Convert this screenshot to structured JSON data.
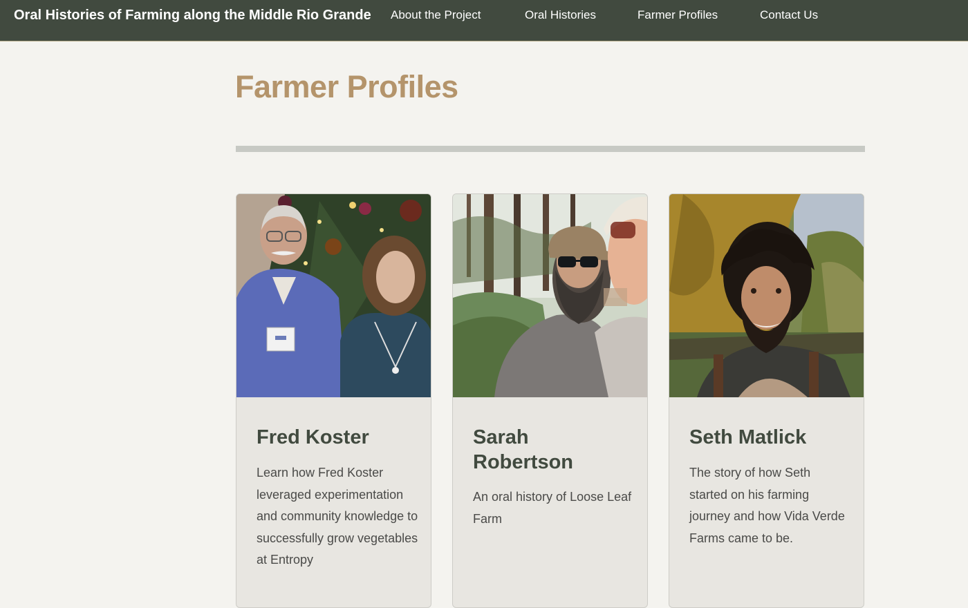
{
  "header": {
    "site_title": "Oral Histories of Farming along the Middle Rio Grande",
    "nav": [
      {
        "label": "About the Project"
      },
      {
        "label": "Oral Histories"
      },
      {
        "label": "Farmer Profiles"
      },
      {
        "label": "Contact Us"
      }
    ]
  },
  "main": {
    "page_title": "Farmer Profiles",
    "profiles": [
      {
        "name": "Fred Koster",
        "description": "Learn how Fred Koster leveraged experimentation and community knowledge to successfully grow vegetables at Entropy"
      },
      {
        "name": "Sarah Robertson",
        "description": "An oral history of Loose Leaf Farm"
      },
      {
        "name": "Seth Matlick",
        "description": "The story of how Seth started on his farming journey and how Vida Verde Farms came to be."
      }
    ]
  },
  "colors": {
    "header_bg": "#414a3f",
    "page_bg": "#f4f3ef",
    "title_accent": "#b4946b",
    "card_bg": "#e8e6e1",
    "divider": "#c7c9c4"
  }
}
